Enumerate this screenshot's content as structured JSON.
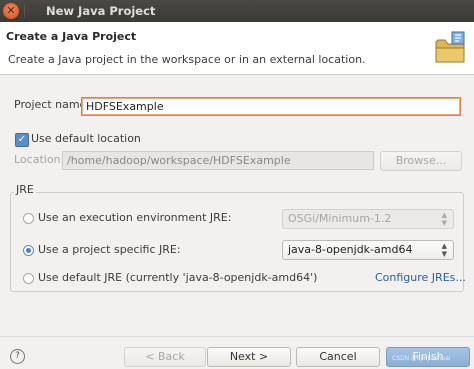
{
  "window": {
    "title": "New Java Project"
  },
  "header": {
    "title": "Create a Java Project",
    "description": "Create a Java project in the workspace or in an external location."
  },
  "project": {
    "label": "Project name:",
    "value": "HDFSExample"
  },
  "location": {
    "use_default_label": "Use default location",
    "use_default_checked": true,
    "label": "Location:",
    "value": "/home/hadoop/workspace/HDFSExample",
    "browse_label": "Browse..."
  },
  "jre": {
    "group_label": "JRE",
    "option_env_label": "Use an execution environment JRE:",
    "option_env_value": "OSGi/Minimum-1.2",
    "option_specific_label": "Use a project specific JRE:",
    "option_specific_value": "java-8-openjdk-amd64",
    "option_default_label": "Use default JRE (currently 'java-8-openjdk-amd64')",
    "configure_link": "Configure JREs...",
    "selected": "specific"
  },
  "buttons": {
    "help": "?",
    "back": "< Back",
    "next": "Next >",
    "cancel": "Cancel",
    "finish": "Finish"
  },
  "watermark": "CSDN @lijinjiashuai",
  "icons": {
    "close": "close-icon",
    "wizard_banner": "folder-icon",
    "checkbox": "check-icon",
    "help": "help-icon"
  },
  "colors": {
    "focus_border": "#f07746",
    "accent": "#4a7fc0",
    "link": "#2a5f9e",
    "titlebar": "#3b3a36"
  }
}
